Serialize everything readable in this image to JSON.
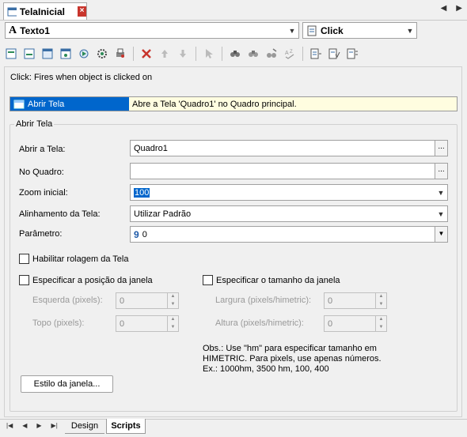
{
  "window": {
    "tab_title": "TelaInicial"
  },
  "object_combo": {
    "value": "Texto1"
  },
  "event_combo": {
    "value": "Click"
  },
  "event_description": "Click: Fires when object is clicked on",
  "action_row": {
    "name": "Abrir Tela",
    "description": "Abre a Tela 'Quadro1' no Quadro principal."
  },
  "group": {
    "title": "Abrir Tela"
  },
  "form": {
    "abrir_label": "Abrir a Tela:",
    "abrir_value": "Quadro1",
    "quadro_label": "No Quadro:",
    "quadro_value": "",
    "zoom_label": "Zoom inicial:",
    "zoom_value": "100",
    "alinhamento_label": "Alinhamento da Tela:",
    "alinhamento_value": "Utilizar Padrão",
    "parametro_label": "Parâmetro:",
    "parametro_value": "0",
    "rolagem_label": "Habilitar rolagem da Tela",
    "posicao_label": "Especificar a posição da janela",
    "tamanho_label": "Especificar o tamanho da janela",
    "esquerda_label": "Esquerda (pixels):",
    "esquerda_value": "0",
    "topo_label": "Topo (pixels):",
    "topo_value": "0",
    "largura_label": "Largura (pixels/himetric):",
    "largura_value": "0",
    "altura_label": "Altura (pixels/himetric):",
    "altura_value": "0",
    "obs_line1": "Obs.: Use \"hm\" para especificar tamanho em",
    "obs_line2": "HIMETRIC. Para pixels, use apenas números.",
    "obs_line3": "Ex.: 1000hm, 3500 hm, 100, 400",
    "estilo_button": "Estilo da janela..."
  },
  "bottom_tabs": {
    "design": "Design",
    "scripts": "Scripts"
  },
  "colors": {
    "selection": "#0066cc",
    "row_highlight": "#fffde0",
    "close": "#c8352d"
  }
}
